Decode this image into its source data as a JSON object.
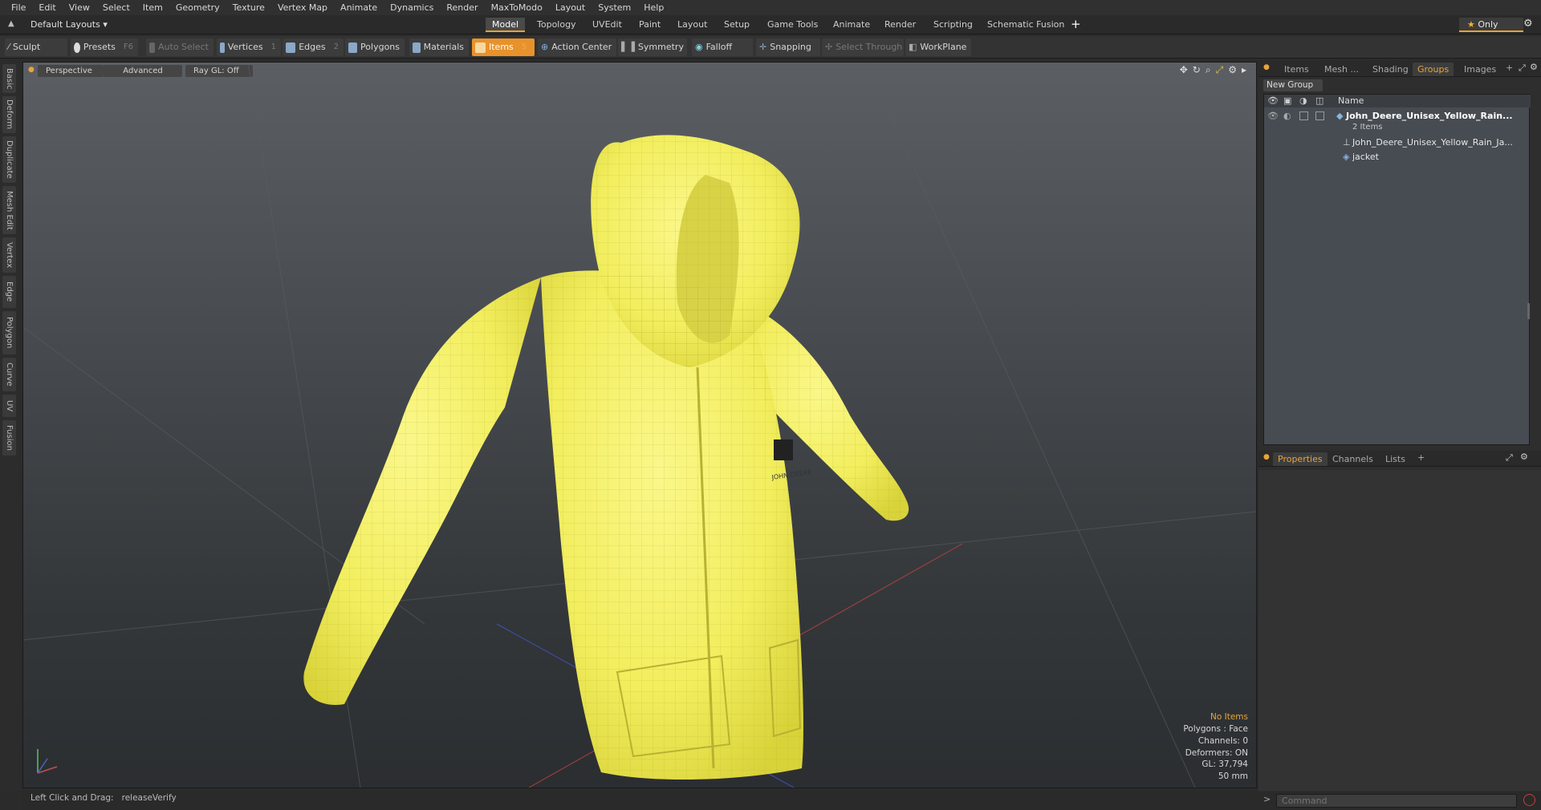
{
  "menu": [
    "File",
    "Edit",
    "View",
    "Select",
    "Item",
    "Geometry",
    "Texture",
    "Vertex Map",
    "Animate",
    "Dynamics",
    "Render",
    "MaxToModo",
    "Layout",
    "System",
    "Help"
  ],
  "layout_selector": "Default Layouts",
  "layout_tabs": [
    "Model",
    "Topology",
    "UVEdit",
    "Paint",
    "Layout",
    "Setup",
    "Game Tools",
    "Animate",
    "Render",
    "Scripting",
    "Schematic Fusion"
  ],
  "layout_tab_active": "Model",
  "only_label": "Only",
  "toolbar": {
    "sculpt": "Sculpt",
    "presets": "Presets",
    "presets_key": "F6",
    "auto_select": "Auto Select",
    "vertices": "Vertices",
    "vertices_key": "1",
    "edges": "Edges",
    "edges_key": "2",
    "polygons": "Polygons",
    "materials": "Materials",
    "items": "Items",
    "items_key": "5",
    "action_center": "Action Center",
    "symmetry": "Symmetry",
    "falloff": "Falloff",
    "snapping": "Snapping",
    "select_through": "Select Through",
    "workplane": "WorkPlane"
  },
  "left_tabs": [
    "Basic",
    "Deform",
    "Duplicate",
    "Mesh Edit",
    "Vertex",
    "Edge",
    "Polygon",
    "Curve",
    "UV",
    "Fusion"
  ],
  "viewport": {
    "view": "Perspective",
    "shading": "Advanced",
    "raygl": "Ray GL: Off",
    "hud": {
      "no_items": "No Items",
      "polygons": "Polygons : Face",
      "channels": "Channels: 0",
      "deformers": "Deformers: ON",
      "gl": "GL: 37,794",
      "focal": "50 mm"
    },
    "logo_text": "JOHN DEERE"
  },
  "status": {
    "hint": "Left Click and Drag:",
    "action": "releaseVerify"
  },
  "right_panel": {
    "tabs": [
      "Items",
      "Mesh ...",
      "Shading",
      "Groups",
      "Images"
    ],
    "active_tab": "Groups",
    "new_group": "New Group",
    "name_header": "Name",
    "group_name": "John_Deere_Unisex_Yellow_Rain...",
    "group_count": "2 Items",
    "children": [
      "John_Deere_Unisex_Yellow_Rain_Ja...",
      "jacket"
    ],
    "bottom_tabs": [
      "Properties",
      "Channels",
      "Lists"
    ],
    "bottom_active": "Properties",
    "command_placeholder": "Command"
  },
  "colors": {
    "accent": "#e8922b",
    "jacket": "#f2ee6a",
    "viewport_top": "#5b5f63",
    "viewport_bottom": "#2b2e31"
  }
}
